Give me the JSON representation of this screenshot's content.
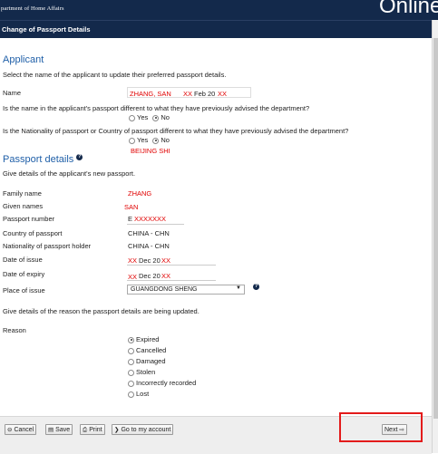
{
  "header": {
    "dept": "partment of Home Affairs",
    "online": "Online"
  },
  "form_title": "Change of Passport Details",
  "applicant": {
    "heading": "Applicant",
    "instruction": "Select the name of the applicant to update their preferred passport details.",
    "name_label": "Name",
    "name_value_1": "ZHANG, SAN",
    "name_value_2": "XX",
    "name_value_3": "Feb 20",
    "name_value_4": "XX",
    "q1": "Is the name in the applicant's passport different to what they have previously advised the department?",
    "q2": "Is the Nationality of passport or Country of passport different to what they have previously advised the department?",
    "yes": "Yes",
    "no": "No",
    "q2_note": "BEIJING SHI"
  },
  "passport": {
    "heading": "Passport details",
    "instruction": "Give details of the applicant's new passport.",
    "family_name_label": "Family name",
    "family_name_value": "ZHANG",
    "given_names_label": "Given names",
    "given_names_value": "SAN",
    "passport_number_label": "Passport number",
    "passport_number_prefix": "E",
    "passport_number_value": "XXXXXXX",
    "country_label": "Country of passport",
    "country_value": "CHINA - CHN",
    "nationality_label": "Nationality of passport holder",
    "nationality_value": "CHINA - CHN",
    "issue_label": "Date of issue",
    "issue_a": "XX",
    "issue_b": "Dec 20",
    "issue_c": "XX",
    "expiry_label": "Date of expiry",
    "expiry_a": "XX",
    "expiry_b": "Dec 20",
    "expiry_c": "XX",
    "place_label": "Place of issue",
    "place_value": "GUANGDONG SHENG"
  },
  "reason": {
    "instruction": "Give details of the reason the passport details are being updated.",
    "label": "Reason",
    "options": [
      "Expired",
      "Cancelled",
      "Damaged",
      "Stolen",
      "Incorrectly recorded",
      "Lost"
    ],
    "selected": "Expired"
  },
  "footer": {
    "cancel": "Cancel",
    "save": "Save",
    "print": "Print",
    "goto": "Go to my account",
    "next": "Next"
  },
  "colors": {
    "navy": "#13294b",
    "heading": "#1f5fa8",
    "annotation": "#e00000"
  }
}
